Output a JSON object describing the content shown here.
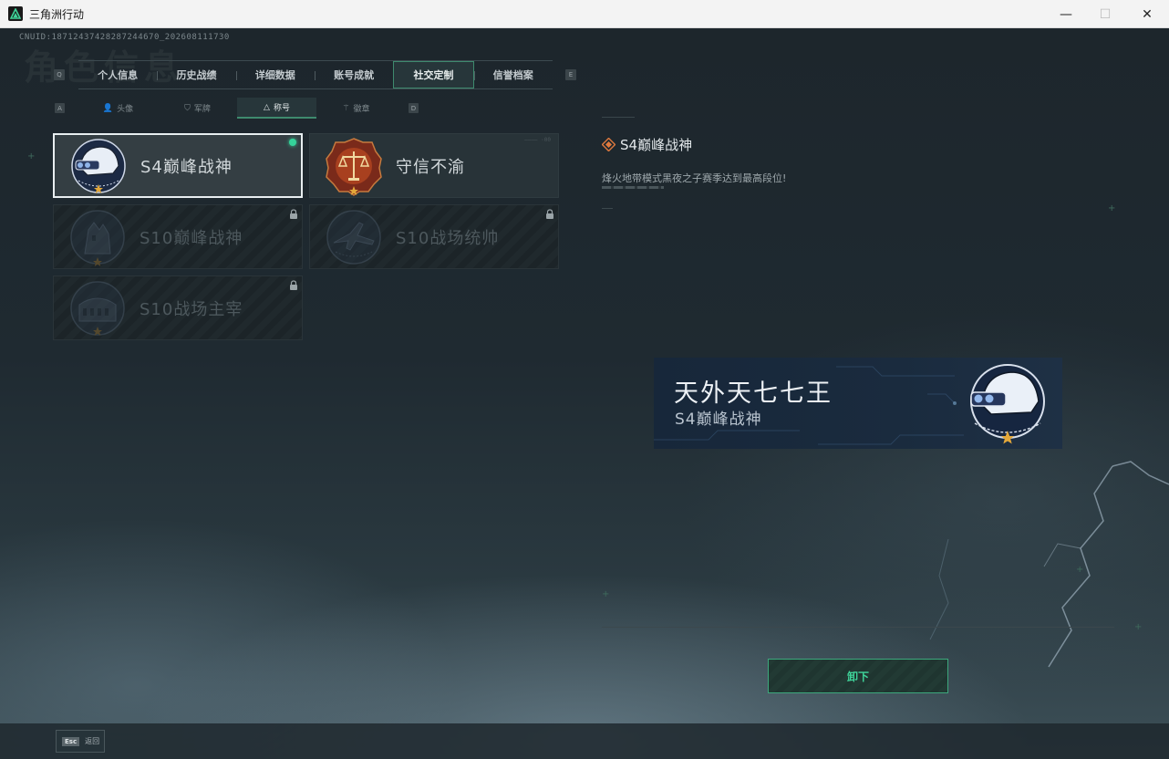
{
  "window": {
    "title": "三角洲行动",
    "minimize": "—",
    "maximize": "☐",
    "close": "✕"
  },
  "header": {
    "cnuid": "CNUID:18712437428287244670_202608111730",
    "background_title": "角色信息"
  },
  "tabs": [
    {
      "label": "个人信息",
      "active": false
    },
    {
      "label": "历史战绩",
      "active": false
    },
    {
      "label": "详细数据",
      "active": false
    },
    {
      "label": "账号成就",
      "active": false
    },
    {
      "label": "社交定制",
      "active": true
    },
    {
      "label": "信誉档案",
      "active": false
    }
  ],
  "tab_keys": {
    "prev": "Q",
    "next": "E"
  },
  "subtabs": [
    {
      "label": "头像",
      "icon": "person-icon",
      "glyph": "👤",
      "active": false
    },
    {
      "label": "军牌",
      "icon": "dogtag-icon",
      "glyph": "⛉",
      "active": false
    },
    {
      "label": "称号",
      "icon": "title-icon",
      "glyph": "△",
      "active": true
    },
    {
      "label": "徽章",
      "icon": "badge-icon",
      "glyph": "⚚",
      "active": false
    }
  ],
  "subtab_keys": {
    "prev": "A",
    "next": "D"
  },
  "titles": [
    {
      "label": "S4巅峰战神",
      "state": "equipped",
      "emblem": "helmet-emblem"
    },
    {
      "label": "守信不渝",
      "state": "owned",
      "emblem": "scales-emblem",
      "serial": "———— ·00"
    },
    {
      "label": "S10巅峰战神",
      "state": "locked",
      "emblem": "tower-emblem"
    },
    {
      "label": "S10战场统帅",
      "state": "locked",
      "emblem": "aircraft-emblem"
    },
    {
      "label": "S10战场主宰",
      "state": "locked",
      "emblem": "colosseum-emblem"
    }
  ],
  "detail": {
    "title": "S4巅峰战神",
    "description": "烽火地带模式黑夜之子赛季达到最高段位!"
  },
  "banner": {
    "player_name": "天外天七七王",
    "title": "S4巅峰战神"
  },
  "action": {
    "unequip_label": "卸下"
  },
  "footer": {
    "esc_key": "Esc",
    "esc_label": "返回"
  },
  "colors": {
    "accent_green": "#3fd49a",
    "equipped_dot": "#35d39a",
    "title_icon": "#e07a3e"
  }
}
